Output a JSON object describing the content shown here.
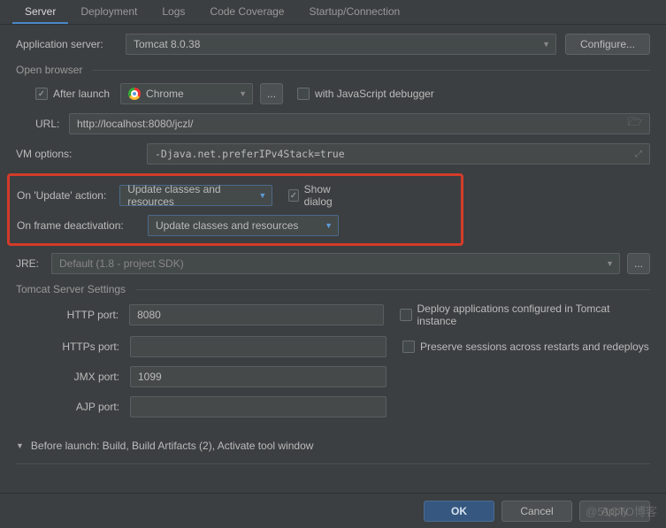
{
  "tabs": {
    "server": "Server",
    "deployment": "Deployment",
    "logs": "Logs",
    "code_coverage": "Code Coverage",
    "startup_connection": "Startup/Connection"
  },
  "app_server": {
    "label": "Application server:",
    "value": "Tomcat 8.0.38",
    "configure": "Configure..."
  },
  "open_browser": {
    "group": "Open browser",
    "after_launch": "After launch",
    "browser": "Chrome",
    "dots": "...",
    "js_debugger": "with JavaScript debugger",
    "url_label": "URL:",
    "url_value": "http://localhost:8080/jczl/"
  },
  "vm_options": {
    "label": "VM options:",
    "value": "-Djava.net.preferIPv4Stack=true"
  },
  "update_action": {
    "label": "On 'Update' action:",
    "value": "Update classes and resources",
    "show_dialog": "Show dialog"
  },
  "frame_deactivation": {
    "label": "On frame deactivation:",
    "value": "Update classes and resources"
  },
  "jre": {
    "label": "JRE:",
    "value": "Default (1.8 - project SDK)",
    "dots": "..."
  },
  "tomcat_settings": {
    "group": "Tomcat Server Settings",
    "http_port_label": "HTTP port:",
    "http_port": "8080",
    "https_port_label": "HTTPs port:",
    "https_port": "",
    "jmx_port_label": "JMX port:",
    "jmx_port": "1099",
    "ajp_port_label": "AJP port:",
    "ajp_port": "",
    "deploy_cb": "Deploy applications configured in Tomcat instance",
    "preserve_cb": "Preserve sessions across restarts and redeploys"
  },
  "before_launch": "Before launch: Build, Build Artifacts (2), Activate tool window",
  "footer": {
    "ok": "OK",
    "cancel": "Cancel",
    "apply": "Apply"
  },
  "watermark": "@51CTO博客"
}
